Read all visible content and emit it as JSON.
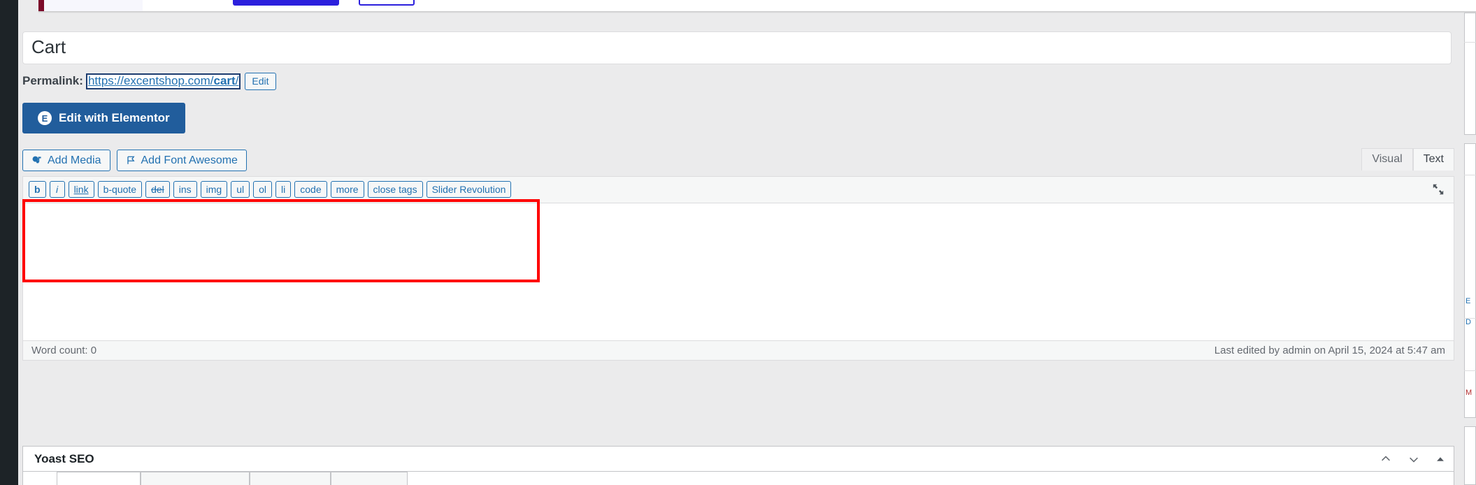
{
  "window": {
    "app": "WordPress Admin — Edit Page"
  },
  "notice": {
    "primary_button_label": "",
    "secondary_button_label": "",
    "accent_primary": "#2c20dd",
    "accent_border": "#7c0a2a"
  },
  "post": {
    "title_value": "Cart",
    "title_placeholder": "Add title",
    "permalink_label": "Permalink:",
    "permalink_prefix": "https://excentshop.com/",
    "permalink_slug": "cart",
    "permalink_suffix": "/",
    "permalink_edit_label": "Edit"
  },
  "elementor": {
    "button_label": "Edit with Elementor",
    "badge_glyph": "E",
    "button_color": "#215d9c"
  },
  "media_buttons": [
    {
      "label": "Add Media",
      "icon": "media-icon"
    },
    {
      "label": "Add Font Awesome",
      "icon": "flag-icon"
    }
  ],
  "editor": {
    "tabs": [
      {
        "label": "Visual",
        "active": false
      },
      {
        "label": "Text",
        "active": true
      }
    ],
    "fullscreen_icon": "fullscreen-icon",
    "content_value": "",
    "quicktags": [
      "b",
      "i",
      "link",
      "b-quote",
      "del",
      "ins",
      "img",
      "ul",
      "ol",
      "li",
      "code",
      "more",
      "close tags",
      "Slider Revolution"
    ],
    "status": {
      "word_count_label": "Word count: 0",
      "last_edited": "Last edited by admin on April 15, 2024 at 5:47 am"
    }
  },
  "yoast": {
    "title": "Yoast SEO",
    "controls": [
      {
        "name": "move-up",
        "glyph": "chevron-up-icon"
      },
      {
        "name": "move-down",
        "glyph": "chevron-down-icon"
      },
      {
        "name": "toggle-panel",
        "glyph": "triangle-up-icon"
      }
    ],
    "tabs": [
      "",
      "",
      "",
      ""
    ]
  },
  "annotation": {
    "color": "#ff0000",
    "shape": "rectangle-highlight"
  }
}
